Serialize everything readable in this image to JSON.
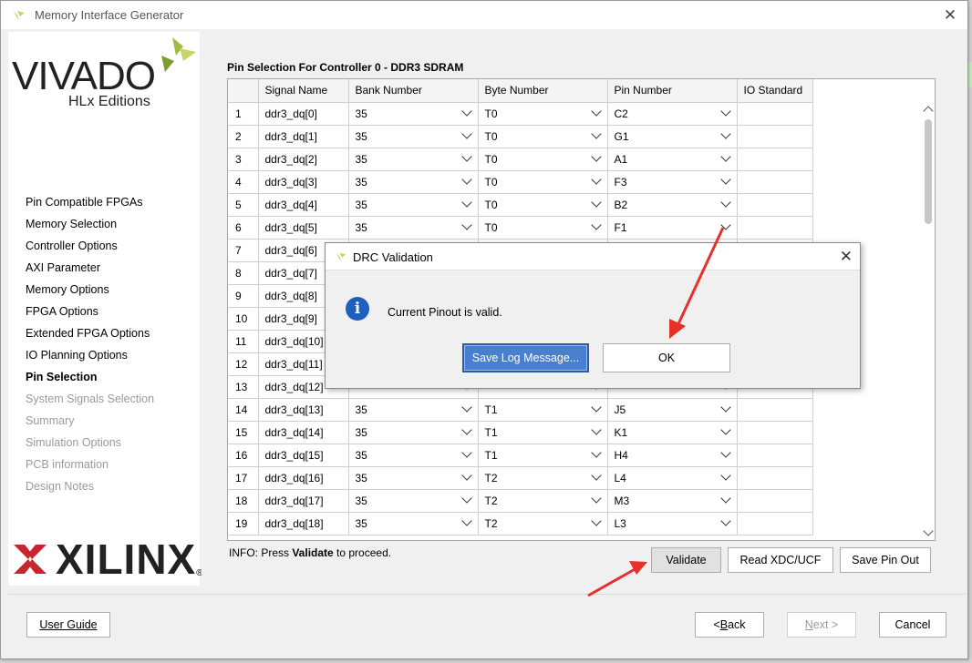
{
  "window": {
    "title": "Memory Interface Generator",
    "close_glyph": "✕"
  },
  "branding": {
    "vivado": "VIVADO",
    "hlx": "HLx Editions",
    "xilinx": "XILINX",
    "registered": "®"
  },
  "nav": [
    {
      "label": "Pin Compatible FPGAs",
      "state": "normal"
    },
    {
      "label": "Memory Selection",
      "state": "normal"
    },
    {
      "label": "Controller Options",
      "state": "normal"
    },
    {
      "label": "AXI Parameter",
      "state": "normal"
    },
    {
      "label": "Memory Options",
      "state": "normal"
    },
    {
      "label": "FPGA Options",
      "state": "normal"
    },
    {
      "label": "Extended FPGA Options",
      "state": "normal"
    },
    {
      "label": "IO Planning Options",
      "state": "normal"
    },
    {
      "label": "Pin Selection",
      "state": "active"
    },
    {
      "label": "System Signals Selection",
      "state": "disabled"
    },
    {
      "label": "Summary",
      "state": "disabled"
    },
    {
      "label": "Simulation Options",
      "state": "disabled"
    },
    {
      "label": "PCB information",
      "state": "disabled"
    },
    {
      "label": "Design Notes",
      "state": "disabled"
    }
  ],
  "main": {
    "section_title": "Pin Selection For Controller 0 - DDR3 SDRAM",
    "columns": [
      "",
      "Signal Name",
      "Bank Number",
      "Byte Number",
      "Pin Number",
      "IO Standard"
    ],
    "rows": [
      {
        "n": "1",
        "signal": "ddr3_dq[0]",
        "bank": "35",
        "byte": "T0",
        "pin": "C2"
      },
      {
        "n": "2",
        "signal": "ddr3_dq[1]",
        "bank": "35",
        "byte": "T0",
        "pin": "G1"
      },
      {
        "n": "3",
        "signal": "ddr3_dq[2]",
        "bank": "35",
        "byte": "T0",
        "pin": "A1"
      },
      {
        "n": "4",
        "signal": "ddr3_dq[3]",
        "bank": "35",
        "byte": "T0",
        "pin": "F3"
      },
      {
        "n": "5",
        "signal": "ddr3_dq[4]",
        "bank": "35",
        "byte": "T0",
        "pin": "B2"
      },
      {
        "n": "6",
        "signal": "ddr3_dq[5]",
        "bank": "35",
        "byte": "T0",
        "pin": "F1"
      },
      {
        "n": "7",
        "signal": "ddr3_dq[6]",
        "bank": "",
        "byte": "",
        "pin": ""
      },
      {
        "n": "8",
        "signal": "ddr3_dq[7]",
        "bank": "",
        "byte": "",
        "pin": ""
      },
      {
        "n": "9",
        "signal": "ddr3_dq[8]",
        "bank": "",
        "byte": "",
        "pin": ""
      },
      {
        "n": "10",
        "signal": "ddr3_dq[9]",
        "bank": "",
        "byte": "",
        "pin": ""
      },
      {
        "n": "11",
        "signal": "ddr3_dq[10]",
        "bank": "",
        "byte": "",
        "pin": ""
      },
      {
        "n": "12",
        "signal": "ddr3_dq[11]",
        "bank": "",
        "byte": "",
        "pin": ""
      },
      {
        "n": "13",
        "signal": "ddr3_dq[12]",
        "bank": "",
        "byte": "",
        "pin": ""
      },
      {
        "n": "14",
        "signal": "ddr3_dq[13]",
        "bank": "35",
        "byte": "T1",
        "pin": "J5"
      },
      {
        "n": "15",
        "signal": "ddr3_dq[14]",
        "bank": "35",
        "byte": "T1",
        "pin": "K1"
      },
      {
        "n": "16",
        "signal": "ddr3_dq[15]",
        "bank": "35",
        "byte": "T1",
        "pin": "H4"
      },
      {
        "n": "17",
        "signal": "ddr3_dq[16]",
        "bank": "35",
        "byte": "T2",
        "pin": "L4"
      },
      {
        "n": "18",
        "signal": "ddr3_dq[17]",
        "bank": "35",
        "byte": "T2",
        "pin": "M3"
      },
      {
        "n": "19",
        "signal": "ddr3_dq[18]",
        "bank": "35",
        "byte": "T2",
        "pin": "L3"
      }
    ],
    "info_prefix": "INFO: Press ",
    "info_bold": "Validate",
    "info_suffix": " to proceed.",
    "validate_label": "Validate",
    "read_xdc_label": "Read XDC/UCF",
    "save_pin_label": "Save Pin Out"
  },
  "footer": {
    "user_guide": "User Guide",
    "back_prefix": "< ",
    "back_key": "B",
    "back_rest": "ack",
    "next_key": "N",
    "next_rest": "ext >",
    "cancel": "Cancel"
  },
  "dialog": {
    "title": "DRC Validation",
    "close_glyph": "✕",
    "info_glyph": "i",
    "message": "Current Pinout is valid.",
    "save_log_label": "Save Log Message...",
    "ok_label": "OK"
  },
  "colors": {
    "accent_blue": "#4a7fd0",
    "arrow_red": "#e8302a",
    "leaf_green": "#a3b745"
  }
}
